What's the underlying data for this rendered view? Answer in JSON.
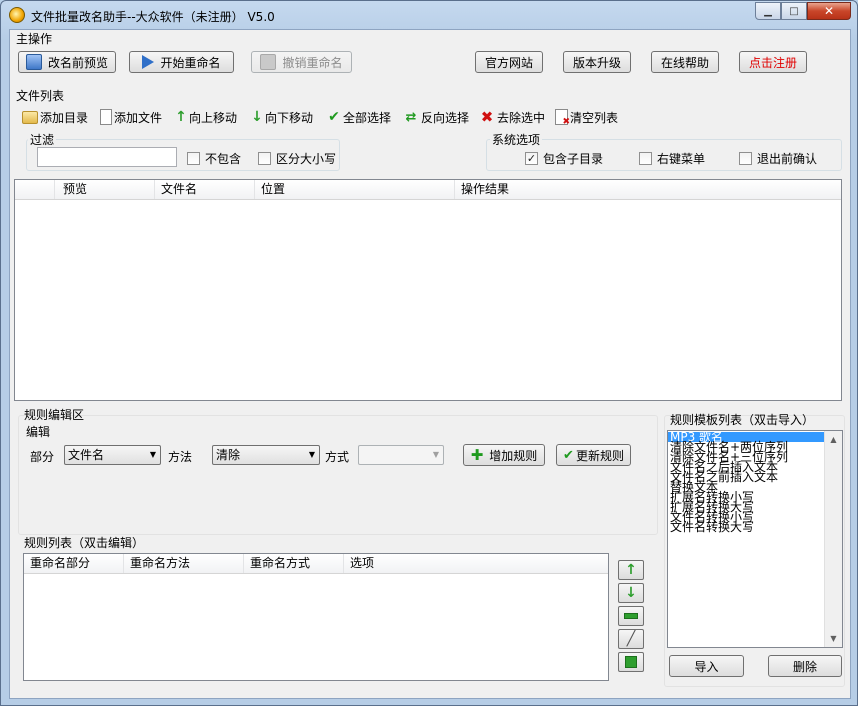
{
  "window": {
    "title": "文件批量改名助手--大众软件（未注册） V5.0",
    "caption_buttons": [
      "minimize",
      "maximize",
      "close"
    ]
  },
  "main_ops": {
    "label": "主操作",
    "preview": "改名前预览",
    "start": "开始重命名",
    "undo": "撤销重命名",
    "website": "官方网站",
    "upgrade": "版本升级",
    "help": "在线帮助",
    "register": "点击注册"
  },
  "file_list": {
    "label": "文件列表",
    "toolbar": {
      "add_dir": "添加目录",
      "add_file": "添加文件",
      "move_up": "向上移动",
      "move_down": "向下移动",
      "select_all": "全部选择",
      "invert": "反向选择",
      "remove": "去除选中",
      "clear": "清空列表"
    },
    "filter": {
      "label": "过滤",
      "value": "",
      "exclude": "不包含",
      "exclude_checked": false,
      "case": "区分大小写",
      "case_checked": false
    },
    "system": {
      "label": "系统选项",
      "subdirs": "包含子目录",
      "subdirs_checked": true,
      "context_menu": "右键菜单",
      "context_menu_checked": false,
      "confirm_exit": "退出前确认",
      "confirm_exit_checked": false
    },
    "columns": [
      "",
      "预览",
      "文件名",
      "位置",
      "操作结果"
    ],
    "rows": []
  },
  "rule_edit": {
    "label": "规则编辑区",
    "edit_label": "编辑",
    "part_label": "部分",
    "part_value": "文件名",
    "method_label": "方法",
    "method_value": "清除",
    "mode_label": "方式",
    "mode_value": "",
    "add_rule": "增加规则",
    "update_rule": "更新规则"
  },
  "rule_list": {
    "label": "规则列表（双击编辑）",
    "columns": [
      "重命名部分",
      "重命名方法",
      "重命名方式",
      "选项"
    ],
    "rows": []
  },
  "templates": {
    "label": "规则模板列表（双击导入）",
    "items": [
      "MP3 歌名",
      "清除文件名+两位序列",
      "清除文件名+三位序列",
      "文件名之后插入文本",
      "文件名之前插入文本",
      "替换文本",
      "扩展名转换小写",
      "扩展名转换大写",
      "文件名转换小写",
      "文件名转换大写"
    ],
    "selected_index": 0,
    "import": "导入",
    "delete": "删除"
  },
  "colors": {
    "accent": "#3399ff",
    "register_text": "#e00000"
  }
}
